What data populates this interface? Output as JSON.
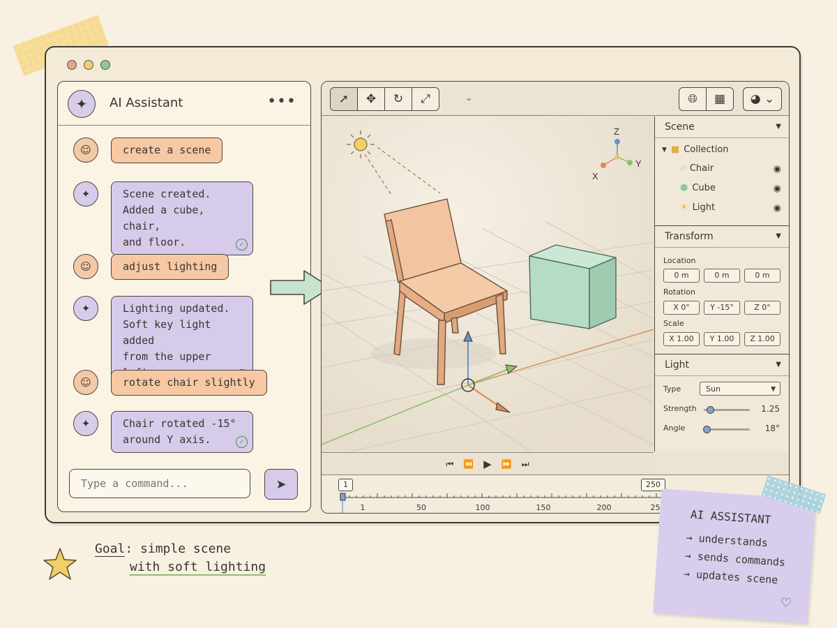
{
  "window": {
    "traffic_lights": [
      "#e7a38a",
      "#f1cf78",
      "#8fc99a"
    ]
  },
  "chat": {
    "title": "AI Assistant",
    "menu_icon": "more-dots-icon",
    "messages": [
      {
        "role": "user",
        "text": "create a scene"
      },
      {
        "role": "ai",
        "text": "Scene created.\nAdded a cube, chair,\nand floor.",
        "done": true
      },
      {
        "role": "user",
        "text": "adjust lighting"
      },
      {
        "role": "ai",
        "text": "Lighting updated.\nSoft key light added\nfrom the upper left.",
        "done": true
      },
      {
        "role": "user",
        "text": "rotate chair slightly"
      },
      {
        "role": "ai",
        "text": "Chair rotated -15°\naround Y axis.",
        "done": true
      }
    ],
    "input_placeholder": "Type a command..."
  },
  "toolbar": {
    "tools": [
      "select-tool",
      "move-tool",
      "rotate-tool",
      "scale-tool"
    ],
    "view_buttons": [
      "globe-icon",
      "grid-icon",
      "shading-icon"
    ]
  },
  "viewport": {
    "axis_labels": {
      "z": "Z",
      "y": "Y",
      "x": "X"
    },
    "colors": {
      "chair": "#f2c4a0",
      "cube": "#b7dcc6",
      "x_axis": "#d98a56",
      "y_axis": "#8dbf6e",
      "z_axis": "#6b8fc6"
    }
  },
  "outliner": {
    "title": "Scene",
    "collection": "Collection",
    "items": [
      {
        "name": "Chair",
        "icon": "chair-icon"
      },
      {
        "name": "Cube",
        "icon": "cube-icon"
      },
      {
        "name": "Light",
        "icon": "sun-icon"
      }
    ]
  },
  "transform": {
    "title": "Transform",
    "location_label": "Location",
    "location": [
      "0 m",
      "0 m",
      "0 m"
    ],
    "rotation_label": "Rotation",
    "rotation": [
      "X  0°",
      "Y  -15°",
      "Z  0°"
    ],
    "scale_label": "Scale",
    "scale": [
      "X  1.00",
      "Y  1.00",
      "Z  1.00"
    ]
  },
  "light": {
    "title": "Light",
    "type_label": "Type",
    "type_value": "Sun",
    "strength_label": "Strength",
    "strength_value": "1.25",
    "strength_fraction": 0.12,
    "angle_label": "Angle",
    "angle_value": "18°",
    "angle_fraction": 0.05
  },
  "timeline": {
    "current_frame": "1",
    "end_frame": "250",
    "ticks": [
      "1",
      "50",
      "100",
      "150",
      "200",
      "250"
    ]
  },
  "notes": {
    "goal_prefix": "Goal",
    "goal_line1": ": simple scene",
    "goal_line2": "with soft lighting",
    "sticky_title": "AI ASSISTANT",
    "sticky_lines": [
      "→ understands",
      "→ sends commands",
      "→ updates scene"
    ]
  }
}
